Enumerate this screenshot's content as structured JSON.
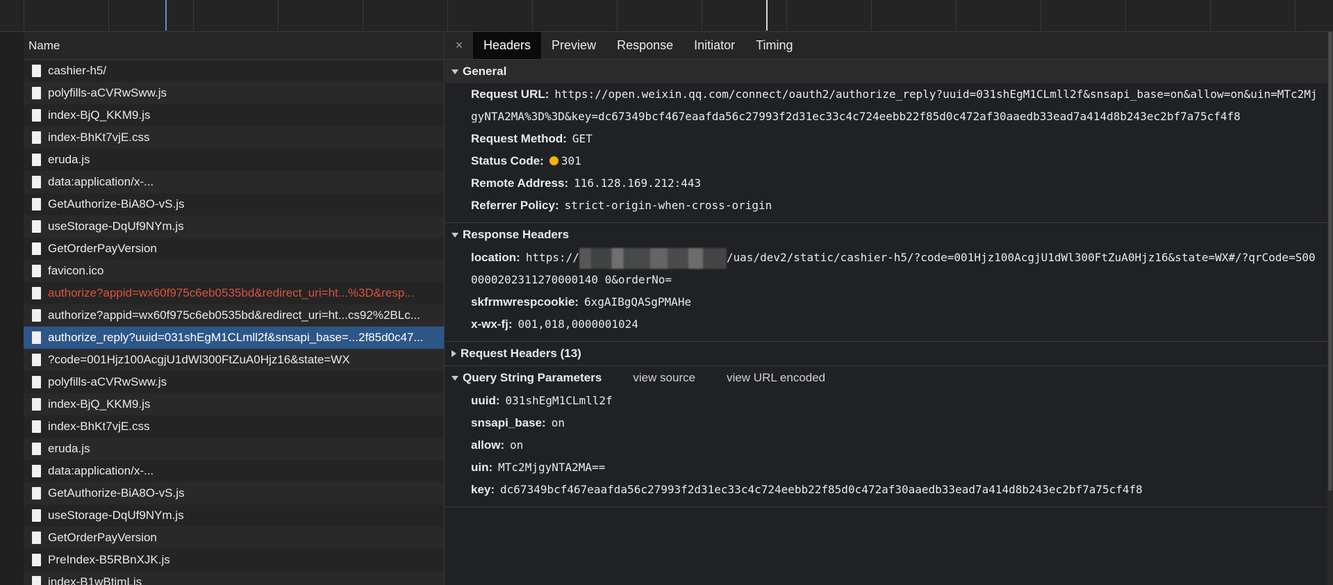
{
  "list": {
    "header": "Name",
    "rows": [
      {
        "name": "cashier-h5/",
        "state": "normal"
      },
      {
        "name": "polyfills-aCVRwSww.js",
        "state": "normal"
      },
      {
        "name": "index-BjQ_KKM9.js",
        "state": "normal"
      },
      {
        "name": "index-BhKt7vjE.css",
        "state": "normal"
      },
      {
        "name": "eruda.js",
        "state": "normal"
      },
      {
        "name": "data:application/x-...",
        "state": "normal"
      },
      {
        "name": "GetAuthorize-BiA8O-vS.js",
        "state": "normal"
      },
      {
        "name": "useStorage-DqUf9NYm.js",
        "state": "normal"
      },
      {
        "name": "GetOrderPayVersion",
        "state": "normal"
      },
      {
        "name": "favicon.ico",
        "state": "normal"
      },
      {
        "name": "authorize?appid=wx60f975c6eb0535bd&redirect_uri=ht...%3D&resp...",
        "state": "error"
      },
      {
        "name": "authorize?appid=wx60f975c6eb0535bd&redirect_uri=ht...cs92%2BLc...",
        "state": "normal"
      },
      {
        "name": "authorize_reply?uuid=031shEgM1CLmll2f&snsapi_base=...2f85d0c47...",
        "state": "selected"
      },
      {
        "name": "?code=001Hjz100AcgjU1dWl300FtZuA0Hjz16&state=WX",
        "state": "normal"
      },
      {
        "name": "polyfills-aCVRwSww.js",
        "state": "normal"
      },
      {
        "name": "index-BjQ_KKM9.js",
        "state": "normal"
      },
      {
        "name": "index-BhKt7vjE.css",
        "state": "normal"
      },
      {
        "name": "eruda.js",
        "state": "normal"
      },
      {
        "name": "data:application/x-...",
        "state": "normal"
      },
      {
        "name": "GetAuthorize-BiA8O-vS.js",
        "state": "normal"
      },
      {
        "name": "useStorage-DqUf9NYm.js",
        "state": "normal"
      },
      {
        "name": "GetOrderPayVersion",
        "state": "normal"
      },
      {
        "name": "PreIndex-B5RBnXJK.js",
        "state": "normal"
      },
      {
        "name": "index-B1wBtimLjs",
        "state": "normal"
      }
    ]
  },
  "tabs": {
    "close": "×",
    "items": [
      "Headers",
      "Preview",
      "Response",
      "Initiator",
      "Timing"
    ],
    "active": "Headers"
  },
  "general": {
    "title": "General",
    "request_url_label": "Request URL:",
    "request_url": "https://open.weixin.qq.com/connect/oauth2/authorize_reply?uuid=031shEgM1CLmll2f&snsapi_base=on&allow=on&uin=MTc2MjgyNTA2MA%3D%3D&key=dc67349bcf467eaafda56c27993f2d31ec33c4c724eebb22f85d0c472af30aaedb33ead7a414d8b243ec2bf7a75cf4f8",
    "request_method_label": "Request Method:",
    "request_method": "GET",
    "status_code_label": "Status Code:",
    "status_code": "301",
    "status_color": "#f5b400",
    "remote_address_label": "Remote Address:",
    "remote_address": "116.128.169.212:443",
    "referrer_policy_label": "Referrer Policy:",
    "referrer_policy": "strict-origin-when-cross-origin"
  },
  "response_headers": {
    "title": "Response Headers",
    "location_label": "location:",
    "location_prefix": "https://",
    "location_suffix": "/uas/dev2/static/cashier-h5/?code=001Hjz100AcgjU1dWl300FtZuA0Hjz16&state=WX#/?qrCode=S000000202311270000140 0&orderNo=",
    "skfrmwrespcookie_label": "skfrmwrespcookie:",
    "skfrmwrespcookie": "6xgAIBgQASgPMAHe",
    "xwxfj_label": "x-wx-fj:",
    "xwxfj": "001,018,0000001024"
  },
  "request_headers": {
    "title": "Request Headers (13)"
  },
  "query_params": {
    "title": "Query String Parameters",
    "view_source": "view source",
    "view_url_encoded": "view URL encoded",
    "items": [
      {
        "key": "uuid:",
        "value": "031shEgM1CLmll2f"
      },
      {
        "key": "snsapi_base:",
        "value": "on"
      },
      {
        "key": "allow:",
        "value": "on"
      },
      {
        "key": "uin:",
        "value": "MTc2MjgyNTA2MA=="
      },
      {
        "key": "key:",
        "value": "dc67349bcf467eaafda56c27993f2d31ec33c4c724eebb22f85d0c472af30aaedb33ead7a414d8b243ec2bf7a75cf4f8"
      }
    ]
  }
}
